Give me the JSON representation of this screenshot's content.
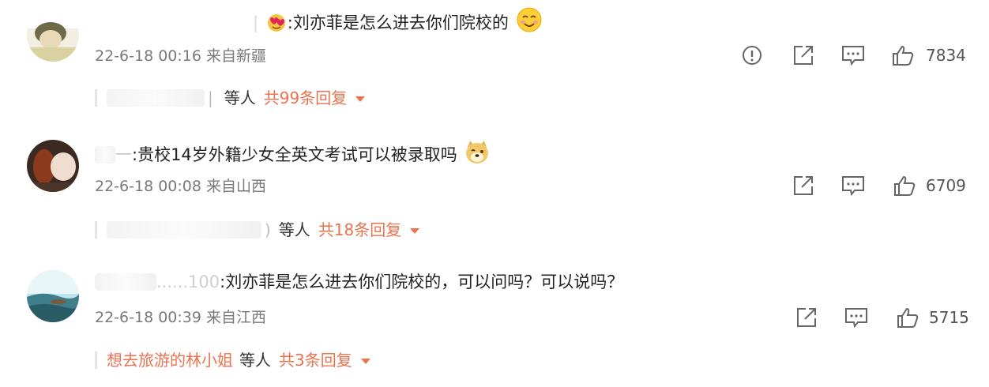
{
  "comments": [
    {
      "username": "|",
      "text": ":刘亦菲是怎么进去你们院校的",
      "emoji_icon": "smile-emoji-icon",
      "name_emoji_icon": "hearts-emoji-icon",
      "timestamp": "22-6-18 00:16",
      "location": "来自新疆",
      "likes": "7834",
      "reply_prefix": "|",
      "replier_name": "",
      "reply_etc": "等人",
      "reply_total": "共99条回复",
      "actions": [
        "report-icon",
        "share-icon",
        "comment-icon",
        "like-icon"
      ]
    },
    {
      "username": "一",
      "text": ":贵校14岁外籍少女全英文考试可以被录取吗",
      "emoji_icon": "doge-emoji-icon",
      "timestamp": "22-6-18 00:08",
      "location": "来自山西",
      "likes": "6709",
      "reply_prefix": ")",
      "replier_name": "",
      "reply_etc": "等人",
      "reply_total": "共18条回复",
      "actions": [
        "share-icon",
        "comment-icon",
        "like-icon"
      ]
    },
    {
      "username": "......100",
      "text": ":刘亦菲是怎么进去你们院校的，可以问吗？可以说吗？",
      "timestamp": "22-6-18 00:39",
      "location": "来自江西",
      "likes": "5715",
      "reply_prefix": "",
      "replier_name": "想去旅游的林小姐",
      "reply_etc": "等人",
      "reply_total": "共3条回复",
      "actions": [
        "share-icon",
        "comment-icon",
        "like-icon"
      ]
    }
  ],
  "colors": {
    "accent": "#eb7350",
    "meta_text": "#7a7a7a",
    "icon": "#666666"
  }
}
